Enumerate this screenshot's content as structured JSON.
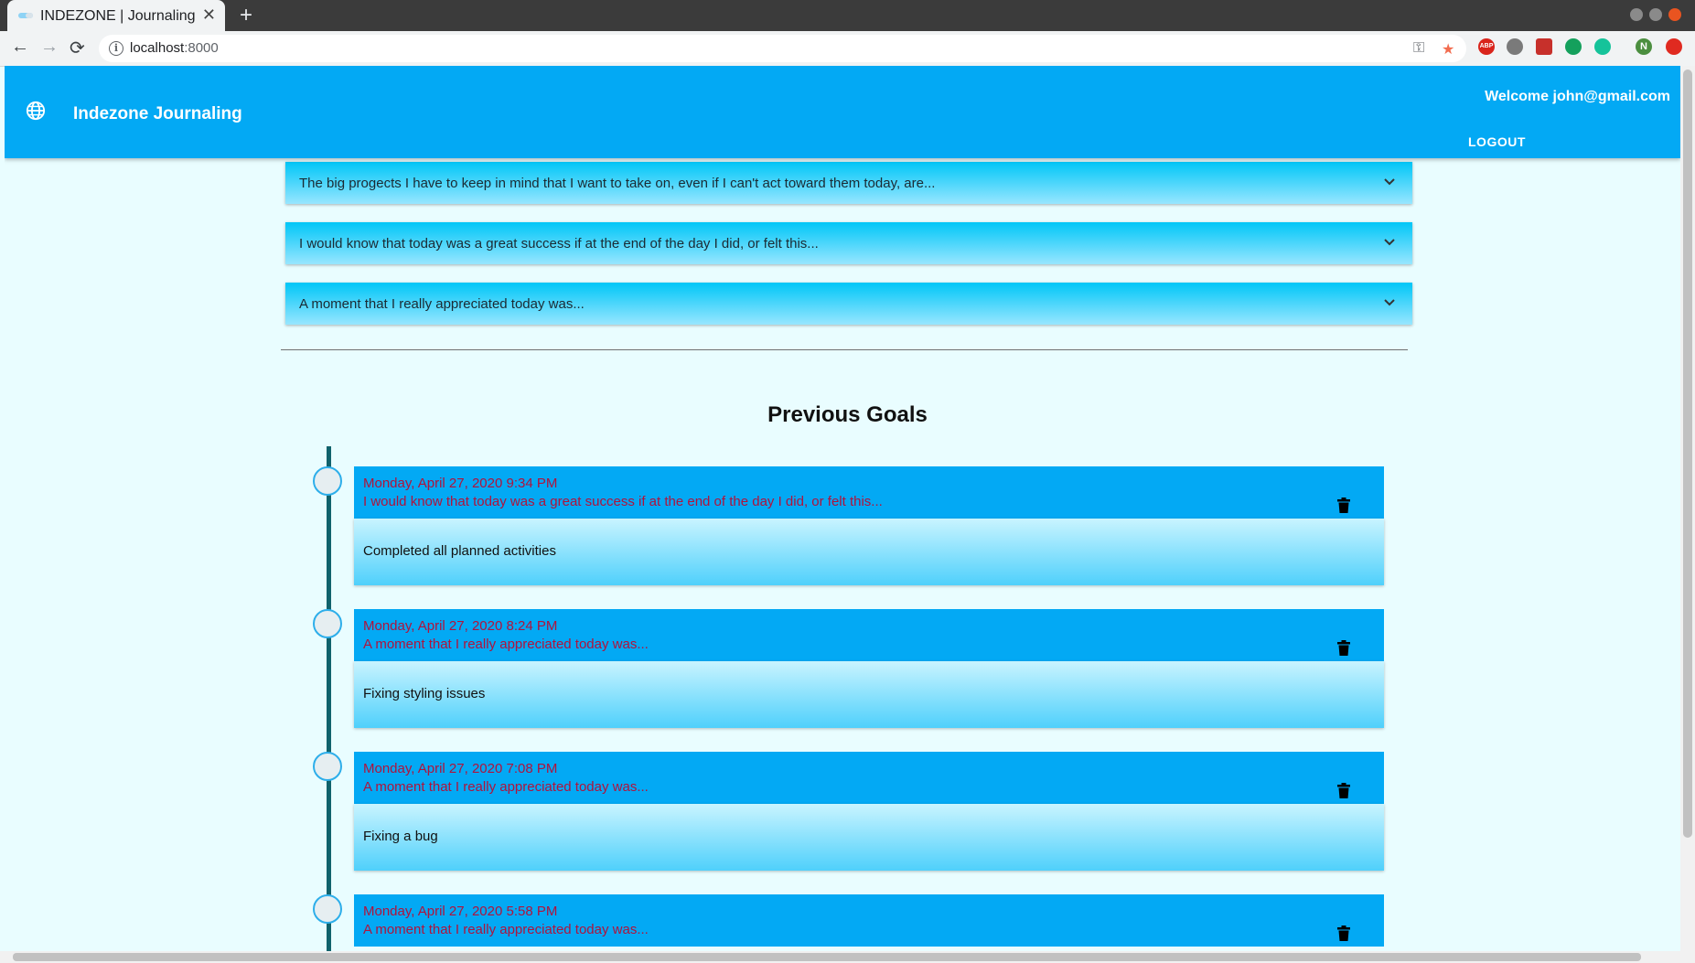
{
  "browser": {
    "tab_title": "INDEZONE | Journaling",
    "tab_close": "✕",
    "new_tab": "+",
    "back": "←",
    "forward": "→",
    "reload": "⟳",
    "url_host": "localhost",
    "url_port": ":8000",
    "extension_profile_letter": "N",
    "extension_abp": "ABP"
  },
  "header": {
    "brand": "Indezone Journaling",
    "welcome": "Welcome john@gmail.com",
    "logout": "LOGOUT"
  },
  "prompts": [
    "The big progects I have to keep in mind that I want to take on, even if I can't act toward them today, are...",
    "I would know that today was a great success if at the end of the day I did, or felt this...",
    "A moment that I really appreciated today was..."
  ],
  "previous_goals": {
    "title": "Previous Goals",
    "entries": [
      {
        "date": "Monday, April 27, 2020 9:34 PM",
        "prompt": "I would know that today was a great success if at the end of the day I did, or felt this...",
        "answer": "Completed all planned activities"
      },
      {
        "date": "Monday, April 27, 2020 8:24 PM",
        "prompt": "A moment that I really appreciated today was...",
        "answer": "Fixing styling issues"
      },
      {
        "date": "Monday, April 27, 2020 7:08 PM",
        "prompt": "A moment that I really appreciated today was...",
        "answer": "Fixing a bug"
      },
      {
        "date": "Monday, April 27, 2020 5:58 PM",
        "prompt": "A moment that I really appreciated today was...",
        "answer": ""
      }
    ]
  },
  "colors": {
    "appbar": "#03a9f4",
    "date_text": "#b0133c",
    "timeline": "#10626c"
  }
}
